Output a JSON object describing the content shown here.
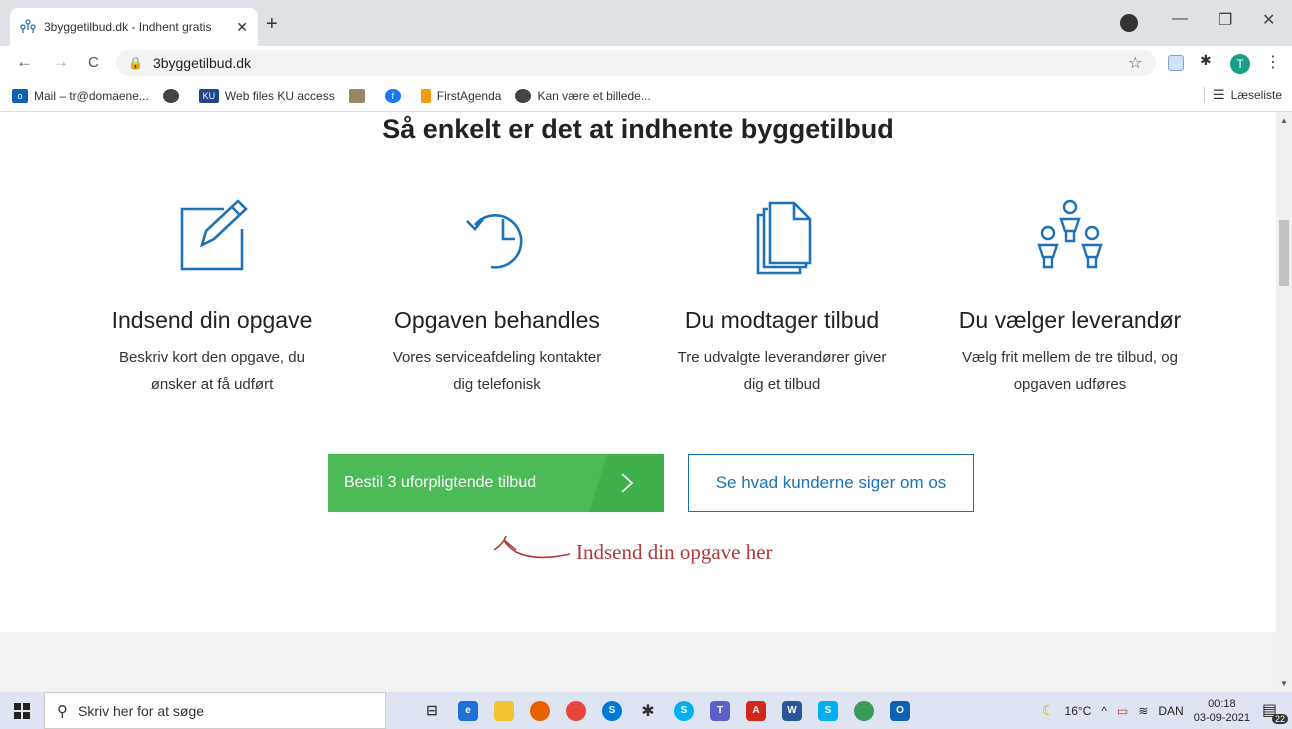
{
  "browser": {
    "tab": {
      "title": "3byggetilbud.dk - Indhent gratis",
      "close": "✕"
    },
    "new_tab": "+",
    "window": {
      "minimize": "—",
      "maximize": "❐",
      "close": "✕"
    },
    "nav": {
      "back": "←",
      "forward": "→",
      "reload": "C"
    },
    "url": "3byggetilbud.dk",
    "avatar_letter": "T",
    "bookmarks": [
      {
        "label": "Mail – tr@domaene...",
        "icon": "outlook-icon"
      },
      {
        "label": "",
        "icon": "globe-icon"
      },
      {
        "label": "Web files KU access",
        "icon": "ku-icon"
      },
      {
        "label": "",
        "icon": "library-icon"
      },
      {
        "label": "",
        "icon": "facebook-icon"
      },
      {
        "label": "FirstAgenda",
        "icon": "firstagenda-icon"
      },
      {
        "label": "Kan være et billede...",
        "icon": "globe-icon"
      }
    ],
    "reading_list": "Læseliste"
  },
  "page": {
    "headline": "Så enkelt er det at indhente byggetilbud",
    "steps": [
      {
        "title": "Indsend din opgave",
        "desc_line1": "Beskriv kort den opgave, du",
        "desc_line2": "ønsker at få udført",
        "icon": "edit-icon"
      },
      {
        "title": "Opgaven behandles",
        "desc_line1": "Vores serviceafdeling kontakter",
        "desc_line2": "dig telefonisk",
        "icon": "history-icon"
      },
      {
        "title": "Du modtager tilbud",
        "desc_line1": "Tre udvalgte leverandører giver",
        "desc_line2": "dig et tilbud",
        "icon": "documents-icon"
      },
      {
        "title": "Du vælger leverandør",
        "desc_line1": "Vælg frit mellem de tre tilbud, og",
        "desc_line2": "opgaven udføres",
        "icon": "people-icon"
      }
    ],
    "cta_primary": "Bestil 3 uforpligtende tilbud",
    "cta_arrow": ">",
    "cta_secondary": "Se hvad kunderne siger om os",
    "annotation": "Indsend din opgave her"
  },
  "taskbar": {
    "search_placeholder": "Skriv her for at søge",
    "weather": "16°C",
    "language": "DAN",
    "time": "00:18",
    "date": "03-09-2021",
    "notifications": "22"
  },
  "colors": {
    "brand_blue": "#1e72b8",
    "cta_green": "#4cbb57",
    "annotation_red": "#b03a3a"
  }
}
